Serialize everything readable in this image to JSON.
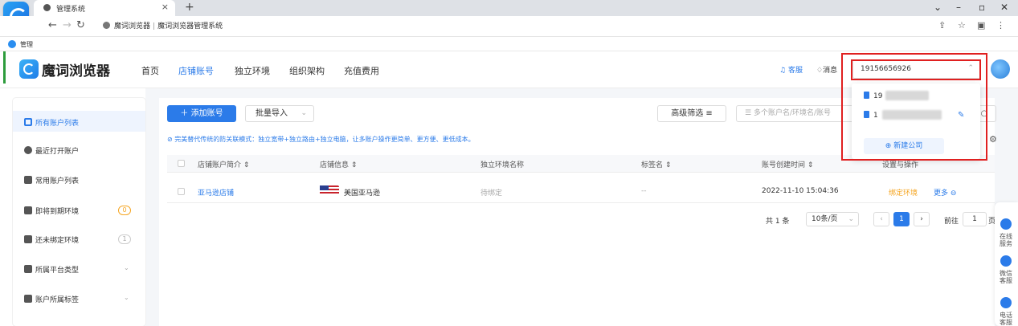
{
  "browser": {
    "tab_title": "管理系统",
    "address_prefix": "魔词浏览器",
    "address_title": "魔词浏览器管理系统",
    "bookmark": "管理"
  },
  "header": {
    "logo_text": "魔词浏览器",
    "nav": [
      "首页",
      "店铺账号",
      "独立环境",
      "组织架构",
      "充值费用"
    ],
    "active_nav": 1,
    "service_link": "客服",
    "message_link": "消息",
    "account_value": "19156656926"
  },
  "account_dropdown": {
    "items": [
      "19",
      "1"
    ],
    "new_company": "新建公司"
  },
  "sidebar": {
    "items": [
      {
        "label": "所有账户列表"
      },
      {
        "label": "最近打开账户"
      },
      {
        "label": "常用账户列表"
      },
      {
        "label": "即将到期环境",
        "badge": "0"
      },
      {
        "label": "还未绑定环境",
        "badge": "1"
      },
      {
        "label": "所属平台类型"
      },
      {
        "label": "账户所属标签"
      }
    ]
  },
  "toolbar": {
    "add_label": "添加账号",
    "import_label": "批量导入",
    "filter_label": "高级筛选",
    "search_placeholder": "多个账户名/环境名/账号"
  },
  "notice": "完美替代传统的防关联模式：独立宽带+独立路由+独立电脑，让多账户操作更简单、更方便、更低成本。",
  "table": {
    "headers": [
      "店铺账户简介",
      "店铺信息",
      "独立环境名称",
      "标签名",
      "账号创建时间",
      "设置与操作"
    ],
    "rows": [
      {
        "name": "亚马逊店铺",
        "platform": "美国亚马逊",
        "env": "待绑定",
        "tag": "--",
        "created": "2022-11-10 15:04:36",
        "action_bind": "绑定环境",
        "action_more": "更多"
      }
    ]
  },
  "pager": {
    "total": "共 1 条",
    "page_size": "10条/页",
    "current": "1",
    "goto_label": "前往",
    "goto_value": "1",
    "page_suffix": "页"
  },
  "rail": [
    "在线服务",
    "微信客服",
    "电话客服"
  ],
  "colors": {
    "accent": "#2b7be9",
    "highlight": "#e02020",
    "warning": "#f5a623"
  }
}
